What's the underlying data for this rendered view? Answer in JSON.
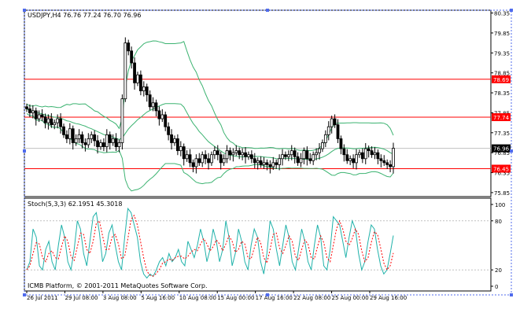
{
  "header": {
    "symbol_line": "USDJPY,H4  76.76 77.24 76.70 76.96",
    "indicator_line": "Stoch(5,3,3) 62.1951 45.3018",
    "copyright": "ICMB Platform, © 2001-2011 MetaQuotes Software Corp."
  },
  "colors": {
    "candle": "#000000",
    "bollinger": "#3cb371",
    "level_line": "#ff0000",
    "level_tag_bg": "#ff0000",
    "current_tag_bg": "#000000",
    "stoch_main": "#20b2aa",
    "stoch_signal": "#ff0000",
    "frame": "#000000",
    "grid_dot": "#4f6bed"
  },
  "price_axis": {
    "ticks": [
      "80.35",
      "79.85",
      "79.35",
      "78.85",
      "78.35",
      "77.85",
      "77.35",
      "76.85",
      "76.35",
      "75.85"
    ],
    "range": [
      75.75,
      80.42
    ]
  },
  "levels": [
    {
      "value": 78.69,
      "label": "78.69"
    },
    {
      "value": 77.74,
      "label": "77.74"
    },
    {
      "value": 76.45,
      "label": "76.45"
    }
  ],
  "current_price": {
    "value": 76.96,
    "label": "76.96"
  },
  "stoch_axis": {
    "ticks": [
      "100",
      "80",
      "20",
      "0"
    ],
    "range": [
      0,
      100
    ]
  },
  "time_axis": {
    "labels": [
      "26 Jul 2011",
      "29 Jul 08:00",
      "3 Aug 08:00",
      "5 Aug 16:00",
      "10 Aug 08:00",
      "15 Aug 00:00",
      "17 Aug 16:00",
      "22 Aug 08:00",
      "25 Aug 00:00",
      "29 Aug 16:00"
    ]
  },
  "chart_data": {
    "type": "candlestick",
    "price_close": [
      77.95,
      77.85,
      77.9,
      77.7,
      77.8,
      77.75,
      77.6,
      77.7,
      77.55,
      77.6,
      77.7,
      77.5,
      77.3,
      77.2,
      77.45,
      77.1,
      77.2,
      77.3,
      77.1,
      77.05,
      77.2,
      77.3,
      77.15,
      77.0,
      77.1,
      77.0,
      77.3,
      77.1,
      77.2,
      77.0,
      77.1,
      78.2,
      79.6,
      79.4,
      79.1,
      78.6,
      78.8,
      78.4,
      78.5,
      78.3,
      78.0,
      78.1,
      77.9,
      77.7,
      77.8,
      77.5,
      77.3,
      77.1,
      77.2,
      76.9,
      77.0,
      76.7,
      76.8,
      76.6,
      76.5,
      76.7,
      76.6,
      76.8,
      76.7,
      76.6,
      76.8,
      76.9,
      76.8,
      76.6,
      76.7,
      76.9,
      76.8,
      76.85,
      76.9,
      76.8,
      76.85,
      76.75,
      76.8,
      76.7,
      76.6,
      76.65,
      76.55,
      76.6,
      76.55,
      76.5,
      76.6,
      76.55,
      76.7,
      76.8,
      76.75,
      76.8,
      76.9,
      76.75,
      76.6,
      76.7,
      76.9,
      76.7,
      76.65,
      76.8,
      76.85,
      76.95,
      77.1,
      77.3,
      77.5,
      77.7,
      77.55,
      77.2,
      76.95,
      76.8,
      76.65,
      76.7,
      76.6,
      76.8,
      76.85,
      76.7,
      76.95,
      76.9,
      76.8,
      76.85,
      76.7,
      76.65,
      76.6,
      76.55,
      76.5,
      76.96
    ],
    "stoch_main": [
      20,
      30,
      70,
      60,
      25,
      20,
      45,
      55,
      30,
      20,
      50,
      75,
      60,
      30,
      20,
      45,
      80,
      70,
      40,
      25,
      55,
      85,
      90,
      65,
      30,
      40,
      65,
      75,
      50,
      30,
      20,
      60,
      95,
      90,
      75,
      60,
      30,
      15,
      10,
      15,
      12,
      20,
      30,
      35,
      25,
      40,
      30,
      35,
      45,
      30,
      25,
      55,
      45,
      35,
      50,
      70,
      55,
      30,
      45,
      70,
      55,
      30,
      45,
      80,
      60,
      25,
      40,
      70,
      55,
      30,
      20,
      50,
      70,
      60,
      30,
      15,
      40,
      80,
      70,
      45,
      25,
      50,
      75,
      60,
      30,
      20,
      45,
      70,
      55,
      30,
      20,
      50,
      75,
      60,
      25,
      20,
      45,
      85,
      80,
      75,
      55,
      35,
      60,
      80,
      70,
      40,
      20,
      30,
      55,
      75,
      70,
      45,
      25,
      15,
      20,
      40,
      62
    ]
  }
}
